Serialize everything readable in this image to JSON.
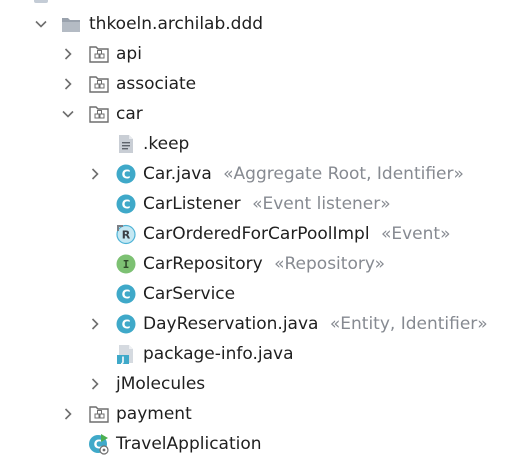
{
  "tree": {
    "root": {
      "label": "thkoeln.archilab.ddd",
      "icon": "folder-icon",
      "expanded": true
    },
    "items": [
      {
        "label": "api",
        "icon": "package-icon",
        "expanded": false
      },
      {
        "label": "associate",
        "icon": "package-icon",
        "expanded": false
      },
      {
        "label": "car",
        "icon": "package-icon",
        "expanded": true
      },
      {
        "label": ".keep",
        "icon": "text-file-icon"
      },
      {
        "label": "Car.java",
        "annotation": "«Aggregate Root, Identifier»",
        "icon": "class-icon",
        "expanded": false
      },
      {
        "label": "CarListener",
        "annotation": "«Event listener»",
        "icon": "class-icon"
      },
      {
        "label": "CarOrderedForCarPoolImpl",
        "annotation": "«Event»",
        "icon": "record-icon"
      },
      {
        "label": "CarRepository",
        "annotation": "«Repository»",
        "icon": "interface-icon"
      },
      {
        "label": "CarService",
        "icon": "class-icon"
      },
      {
        "label": "DayReservation.java",
        "annotation": "«Entity, Identifier»",
        "icon": "class-icon",
        "expanded": false
      },
      {
        "label": "package-info.java",
        "icon": "java-file-icon"
      },
      {
        "label": "jMolecules"
      },
      {
        "label": "payment",
        "icon": "package-icon",
        "expanded": false
      },
      {
        "label": "TravelApplication",
        "icon": "spring-boot-class-icon"
      }
    ]
  },
  "colors": {
    "class_icon": "#3fa9c9",
    "interface_icon": "#7dc173",
    "record_icon": "#4eb3d6",
    "folder_icon": "#9aa2ad",
    "annotation_text": "#868a91",
    "arrow": "#6e6e6e"
  }
}
